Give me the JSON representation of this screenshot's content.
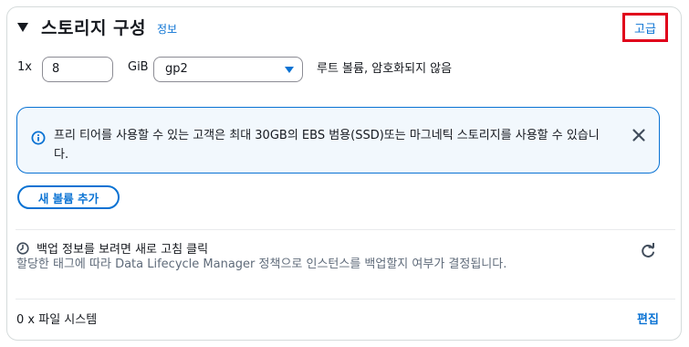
{
  "section": {
    "title": "스토리지 구성",
    "info_link": "정보",
    "advanced_label": "고급"
  },
  "root_volume": {
    "count_label": "1x",
    "size_value": "8",
    "size_unit": "GiB",
    "volume_type": "gp2",
    "description": "루트 볼륨,  암호화되지 않음"
  },
  "alert": {
    "message": "프리 티어를 사용할 수 있는 고객은 최대 30GB의 EBS 범용(SSD)또는 마그네틱 스토리지를 사용할 수 있습니다.",
    "accent_color": "#0972d3"
  },
  "add_volume_label": "새 볼륨 추가",
  "backup": {
    "title": "백업 정보를 보려면 새로 고침 클릭",
    "description": "할당한 태그에 따라 Data Lifecycle Manager 정책으로 인스턴스를 백업할지 여부가 결정됩니다."
  },
  "file_systems": {
    "label": "0 x 파일 시스템",
    "edit_label": "편집"
  },
  "colors": {
    "link": "#0972d3",
    "highlight_border": "#e0001b"
  },
  "icons": [
    "caret-down-icon",
    "info-circle-icon",
    "close-icon",
    "clock-icon",
    "refresh-icon",
    "chevron-down-icon"
  ]
}
